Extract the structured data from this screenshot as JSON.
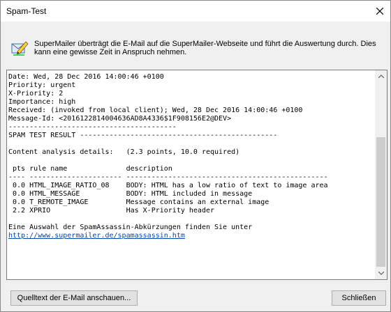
{
  "window": {
    "title": "Spam-Test"
  },
  "info": {
    "icon": "envelope-edit-icon",
    "text": "SuperMailer überträgt die E-Mail auf die SuperMailer-Webseite und führt die Auswertung durch. Dies kann eine gewisse Zeit in Anspruch nehmen."
  },
  "report": {
    "lines": [
      "Date: Wed, 28 Dec 2016 14:00:46 +0100",
      "Priority: urgent",
      "X-Priority: 2",
      "Importance: high",
      "Received: (invoked from local client); Wed, 28 Dec 2016 14:00:46 +0100",
      "Message-Id: <201612281400463 6AD8A4336$1F908156E2@DEV>",
      "----------------------------------------",
      "SPAM TEST RESULT -----------------------------------------------",
      "",
      "Content analysis details:   (2.3 points, 10.0 required)",
      "",
      " pts rule name              description",
      "---- ---------------------- ------------------------------------------------",
      " 0.0 HTML_IMAGE_RATIO_08    BODY: HTML has a low ratio of text to image area",
      " 0.0 HTML_MESSAGE           BODY: HTML included in message",
      " 0.0 T_REMOTE_IMAGE         Message contains an external image",
      " 2.2 XPRIO                  Has X-Priority header",
      "",
      "Eine Auswahl der SpamAssassin-Abkürzungen finden Sie unter"
    ],
    "link": "http://www.supermailer.de/spamassassin.htm"
  },
  "buttons": {
    "view_source": "Quelltext der E-Mail anschauen...",
    "close": "Schließen"
  },
  "colors": {
    "link": "#0645ad",
    "background": "#f0f0f0"
  }
}
